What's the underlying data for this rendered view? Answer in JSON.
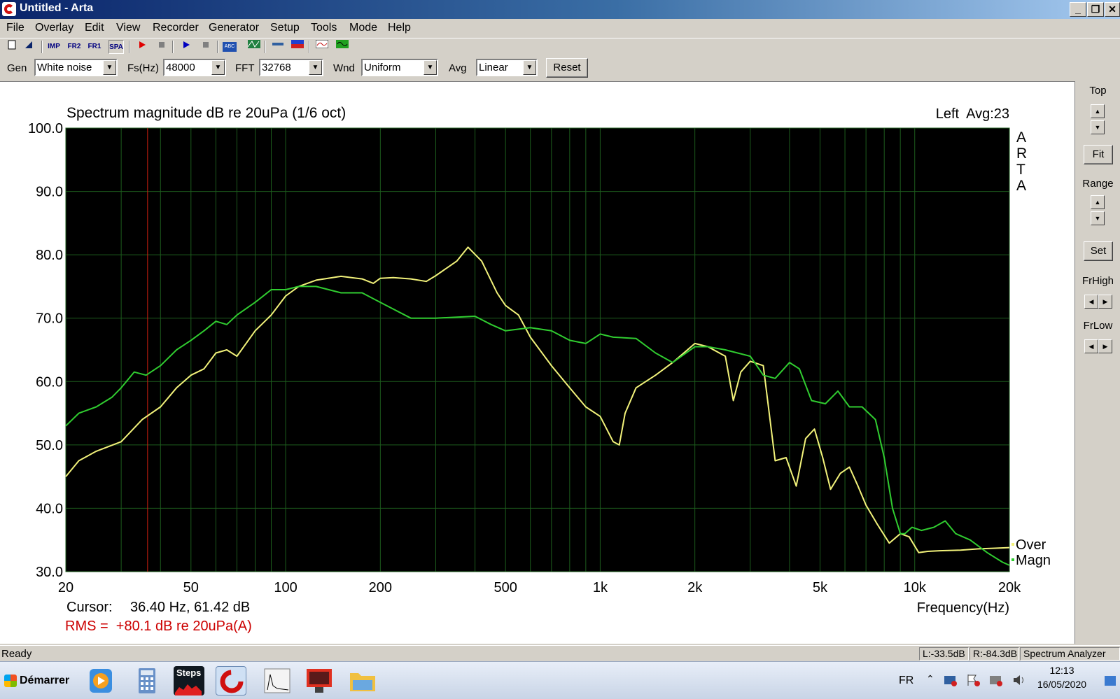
{
  "window": {
    "title": "Untitled - Arta",
    "minimize": "_",
    "maximize": "❐",
    "close": "✕"
  },
  "menu": [
    "File",
    "Overlay",
    "Edit",
    "View",
    "Recorder",
    "Generator",
    "Setup",
    "Tools",
    "Mode",
    "Help"
  ],
  "toolbar_icons": [
    "new-icon",
    "open-icon",
    "impulse-mode-icon",
    "fr2-mode-icon",
    "fr1-mode-icon",
    "spa-mode-icon",
    "record-icon",
    "stop-icon",
    "play-icon",
    "stop-icon",
    "abc-icon",
    "generator-icon",
    "measure-icon",
    "color-icon",
    "scope-icon",
    "waveform-icon"
  ],
  "toolbar_labels": {
    "imp": "IMP",
    "fr2": "FR2",
    "fr1": "FR1",
    "spa": "SPA",
    "abc": "ABC"
  },
  "controls": {
    "gen_label": "Gen",
    "gen_value": "White noise",
    "fs_label": "Fs(Hz)",
    "fs_value": "48000",
    "fft_label": "FFT",
    "fft_value": "32768",
    "wnd_label": "Wnd",
    "wnd_value": "Uniform",
    "avg_label": "Avg",
    "avg_value": "Linear",
    "reset": "Reset"
  },
  "right_panel": {
    "top": "Top",
    "fit": "Fit",
    "range": "Range",
    "set": "Set",
    "frhigh": "FrHigh",
    "frlow": "FrLow"
  },
  "plot": {
    "cursor_label": "Cursor:",
    "cursor_value": "36.40 Hz, 61.42 dB",
    "rms": "RMS =  +80.1 dB re 20uPa(A)"
  },
  "chart_data": {
    "type": "line",
    "title": "Spectrum magnitude dB re 20uPa (1/6 oct)",
    "channel_info": "Left  Avg:23",
    "watermark": [
      "A",
      "R",
      "T",
      "A"
    ],
    "xlabel": "Frequency(Hz)",
    "x_scale": "log",
    "xlim": [
      20,
      20000
    ],
    "ylim": [
      30,
      100
    ],
    "x_ticks": [
      20,
      50,
      100,
      200,
      500,
      1000,
      2000,
      5000,
      10000,
      20000
    ],
    "x_tick_labels": [
      "20",
      "50",
      "100",
      "200",
      "500",
      "1k",
      "2k",
      "5k",
      "10k",
      "20k"
    ],
    "y_ticks": [
      30,
      40,
      50,
      60,
      70,
      80,
      90,
      100
    ],
    "y_tick_labels": [
      "30.0",
      "40.0",
      "50.0",
      "60.0",
      "70.0",
      "80.0",
      "90.0",
      "100.0"
    ],
    "grid": true,
    "legend_position": "bottom-right",
    "cursor_x": 36.4,
    "colors": {
      "background": "#000000",
      "grid": "#1d5c1d",
      "cursor": "#d02010",
      "title_text": "#000000",
      "rms_text": "#cc0000"
    },
    "series": [
      {
        "name": "Over",
        "color": "#f2f27a",
        "x": [
          20,
          22,
          25,
          30,
          35,
          40,
          45,
          50,
          55,
          60,
          65,
          70,
          80,
          90,
          100,
          110,
          125,
          150,
          175,
          190,
          200,
          220,
          250,
          280,
          300,
          350,
          380,
          420,
          470,
          500,
          550,
          600,
          700,
          800,
          900,
          1000,
          1100,
          1150,
          1200,
          1300,
          1500,
          1700,
          2000,
          2200,
          2500,
          2650,
          2800,
          3000,
          3300,
          3600,
          3900,
          4200,
          4500,
          4800,
          5100,
          5400,
          5800,
          6200,
          6600,
          7000,
          7600,
          8300,
          9000,
          9600,
          10300,
          11000,
          12000,
          14000,
          16000,
          18000,
          20000
        ],
        "values": [
          45,
          47.5,
          49,
          50.5,
          54,
          56,
          59,
          61,
          62,
          64.5,
          65,
          64,
          68,
          70.5,
          73.5,
          75,
          76,
          76.6,
          76.2,
          75.5,
          76.3,
          76.4,
          76.2,
          75.8,
          76.7,
          79,
          81.2,
          79,
          74,
          72,
          70.5,
          67,
          62.5,
          59,
          56,
          54.5,
          50.5,
          50,
          55,
          59,
          61,
          63,
          66,
          65.5,
          64,
          57,
          61.5,
          63.2,
          62.5,
          47.5,
          48,
          43.5,
          51,
          52.5,
          48,
          43,
          45.5,
          46.5,
          43.5,
          40.5,
          37.5,
          34.5,
          36,
          35.5,
          33,
          33.2,
          33.3,
          33.4,
          33.6,
          33.7,
          33.8
        ]
      },
      {
        "name": "Magn",
        "color": "#30cc30",
        "x": [
          20,
          22,
          25,
          28,
          30,
          33,
          36,
          40,
          45,
          50,
          55,
          60,
          65,
          70,
          80,
          90,
          100,
          110,
          125,
          150,
          175,
          200,
          250,
          300,
          400,
          450,
          500,
          600,
          700,
          800,
          900,
          1000,
          1100,
          1300,
          1500,
          1700,
          2000,
          2200,
          2500,
          3000,
          3300,
          3600,
          4000,
          4300,
          4700,
          5200,
          5700,
          6200,
          6800,
          7500,
          8000,
          8500,
          9000,
          9300,
          9800,
          10500,
          11500,
          12500,
          13500,
          15000,
          17000,
          19000,
          20000
        ],
        "values": [
          53,
          55,
          56,
          57.5,
          59,
          61.5,
          61,
          62.5,
          65,
          66.5,
          68,
          69.5,
          69,
          70.5,
          72.5,
          74.5,
          74.5,
          75,
          75,
          74,
          74,
          72.5,
          70,
          70,
          70.3,
          69,
          68,
          68.5,
          68,
          66.5,
          66,
          67.5,
          67,
          66.8,
          64.5,
          63,
          65.5,
          65.5,
          65,
          64,
          61,
          60.5,
          63,
          62,
          57,
          56.5,
          58.5,
          56,
          56,
          54,
          48,
          40,
          36,
          36,
          37,
          36.5,
          37,
          38,
          36,
          35,
          33,
          31.5,
          31
        ]
      }
    ]
  },
  "status": {
    "ready": "Ready",
    "left_level": "L:-33.5dB",
    "right_level": "R:-84.3dB",
    "mode": "Spectrum Analyzer"
  },
  "taskbar": {
    "start": "Démarrer",
    "steps": "Steps",
    "lang": "FR",
    "time": "12:13",
    "date": "16/05/2020"
  }
}
